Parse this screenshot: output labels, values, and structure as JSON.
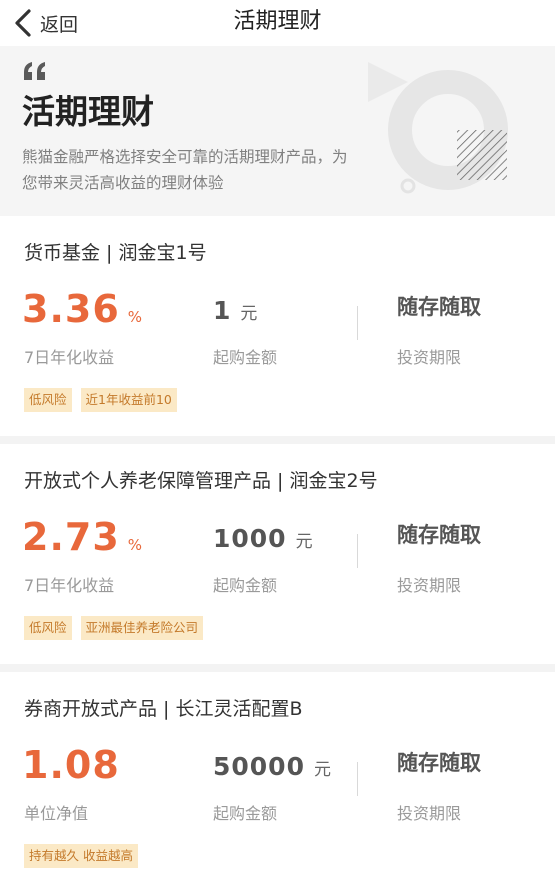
{
  "nav": {
    "back_label": "返回",
    "title": "活期理财"
  },
  "hero": {
    "title": "活期理财",
    "description": "熊猫金融严格选择安全可靠的活期理财产品，为您带来灵活高收益的理财体验"
  },
  "colors": {
    "accent": "#e8683b",
    "tag_bg": "#fbe9c6",
    "tag_text": "#c47a2b",
    "hero_bg": "#f5f5f5"
  },
  "products": [
    {
      "title": "货币基金 | 润金宝1号",
      "rate": "3.36",
      "rate_unit": "%",
      "rate_label": "7日年化收益",
      "amount": "1",
      "amount_unit": "元",
      "amount_label": "起购金额",
      "period": "随存随取",
      "period_label": "投资期限",
      "tags": [
        "低风险",
        "近1年收益前10"
      ]
    },
    {
      "title": "开放式个人养老保障管理产品 | 润金宝2号",
      "rate": "2.73",
      "rate_unit": "%",
      "rate_label": "7日年化收益",
      "amount": "1000",
      "amount_unit": "元",
      "amount_label": "起购金额",
      "period": "随存随取",
      "period_label": "投资期限",
      "tags": [
        "低风险",
        "亚洲最佳养老险公司"
      ]
    },
    {
      "title": "券商开放式产品 | 长江灵活配置B",
      "rate": "1.08",
      "rate_unit": "",
      "rate_label": "单位净值",
      "amount": "50000",
      "amount_unit": "元",
      "amount_label": "起购金额",
      "period": "随存随取",
      "period_label": "投资期限",
      "tags": [
        "持有越久 收益越高"
      ]
    }
  ]
}
